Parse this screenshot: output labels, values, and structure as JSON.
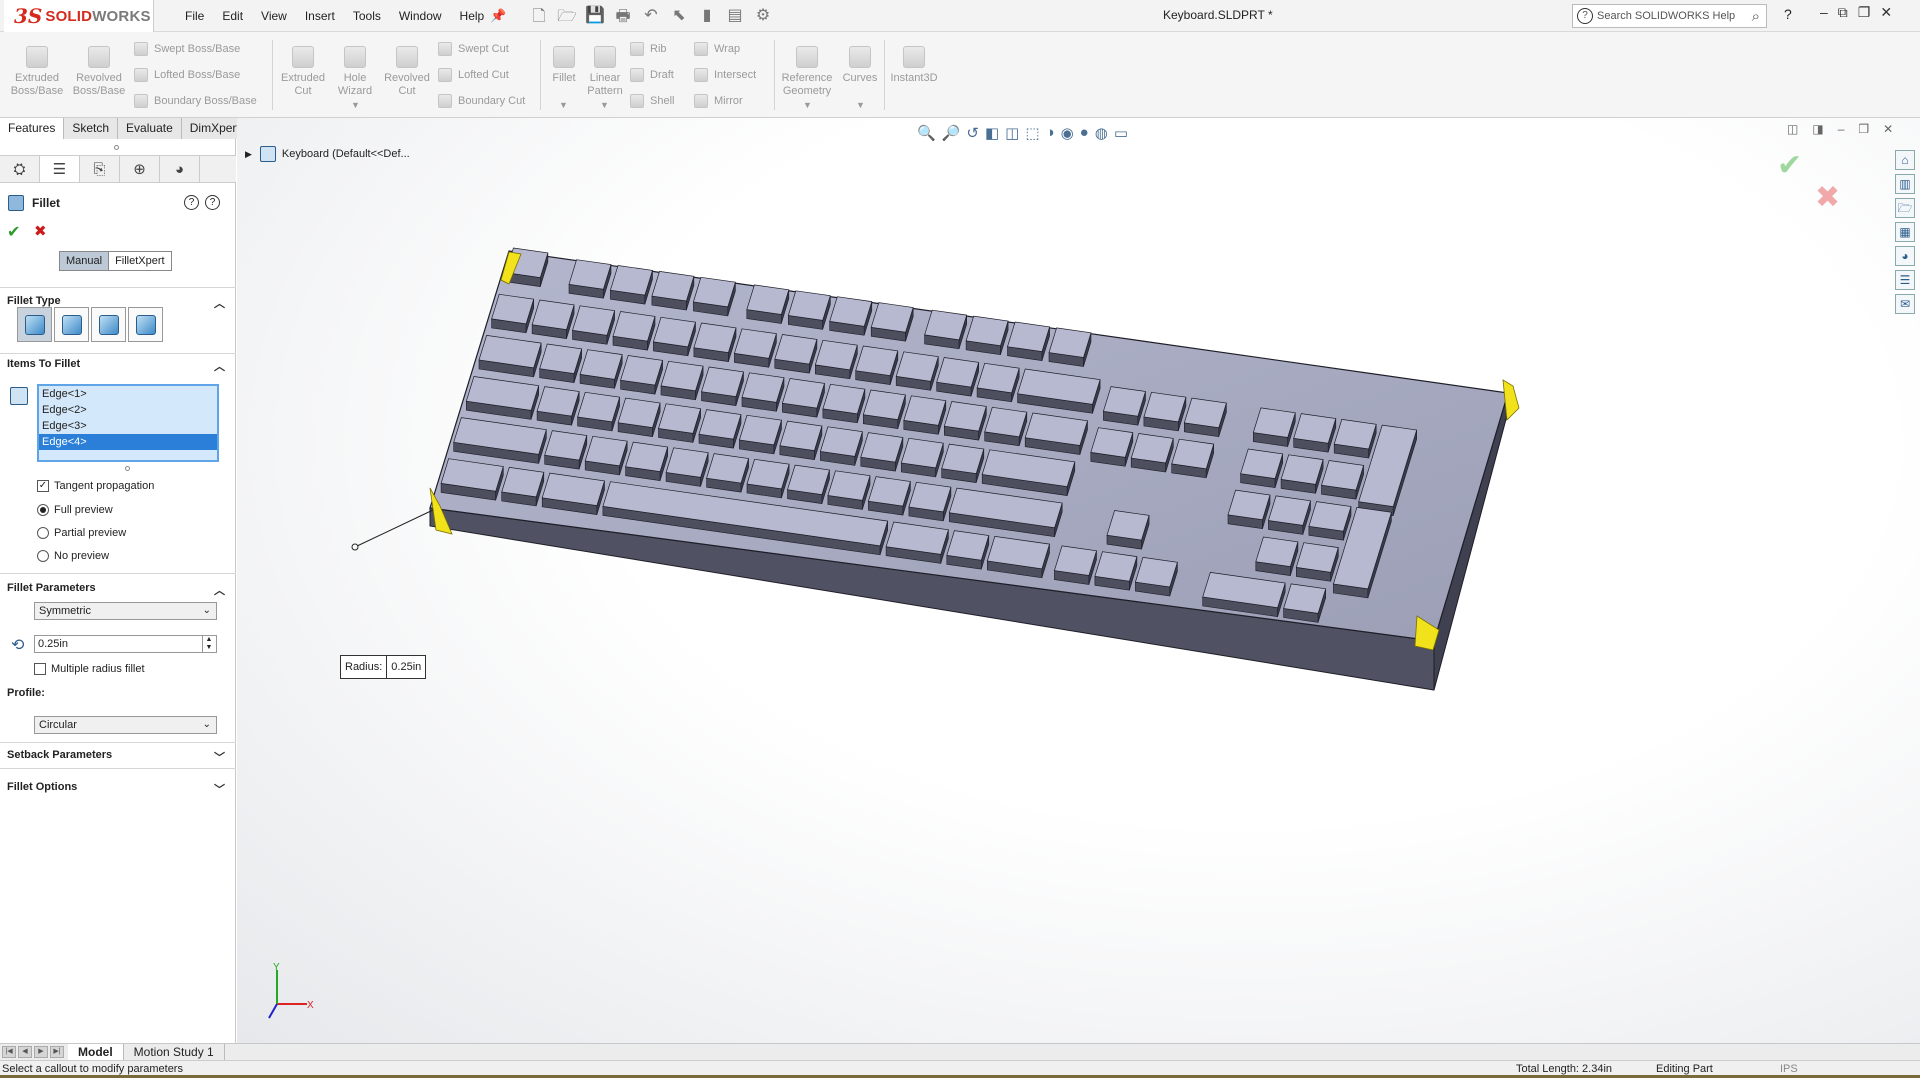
{
  "app": {
    "brand_prefix": "3S",
    "brand_name": "SOLID",
    "brand_suffix": "WORKS",
    "document_title": "Keyboard.SLDPRT *",
    "menus": [
      "File",
      "Edit",
      "View",
      "Insert",
      "Tools",
      "Window",
      "Help"
    ],
    "search_placeholder": "Search SOLIDWORKS Help",
    "help_label": "?"
  },
  "commands": {
    "extruded_boss": "Extruded Boss/Base",
    "revolved_boss": "Revolved Boss/Base",
    "swept_boss": "Swept Boss/Base",
    "lofted_boss": "Lofted Boss/Base",
    "boundary_boss": "Boundary Boss/Base",
    "extruded_cut": "Extruded Cut",
    "hole_wizard": "Hole Wizard",
    "revolved_cut": "Revolved Cut",
    "swept_cut": "Swept Cut",
    "lofted_cut": "Lofted Cut",
    "boundary_cut": "Boundary Cut",
    "fillet": "Fillet",
    "linear_pattern": "Linear Pattern",
    "rib": "Rib",
    "draft": "Draft",
    "shell": "Shell",
    "wrap": "Wrap",
    "intersect": "Intersect",
    "mirror": "Mirror",
    "reference_geometry": "Reference Geometry",
    "curves": "Curves",
    "instant3d": "Instant3D"
  },
  "command_tabs": [
    "Features",
    "Sketch",
    "Evaluate",
    "DimXpert"
  ],
  "property_manager": {
    "title": "Fillet",
    "mode_tabs": [
      "Manual",
      "FilletXpert"
    ],
    "fillet_type": {
      "header": "Fillet Type"
    },
    "items": {
      "header": "Items To Fillet",
      "edges": [
        "Edge<1>",
        "Edge<2>",
        "Edge<3>",
        "Edge<4>"
      ],
      "selected_index": 3,
      "tangent_propagation": "Tangent propagation",
      "full_preview": "Full preview",
      "partial_preview": "Partial preview",
      "no_preview": "No preview"
    },
    "parameters": {
      "header": "Fillet Parameters",
      "method": "Symmetric",
      "radius": "0.25in",
      "multiple_radius": "Multiple radius fillet",
      "profile_label": "Profile:",
      "profile": "Circular"
    },
    "setback": {
      "header": "Setback Parameters"
    },
    "options": {
      "header": "Fillet Options"
    }
  },
  "viewport": {
    "tree_item": "Keyboard  (Default<<Def...",
    "callout_label": "Radius:",
    "callout_value": "0.25in",
    "axis_x": "X",
    "axis_y": "Y"
  },
  "bottom_tabs": [
    "Model",
    "Motion Study 1"
  ],
  "status": {
    "message": "Select a callout to modify parameters",
    "total_length": "Total Length: 2.34in",
    "mode": "Editing Part",
    "units": "IPS"
  },
  "colors": {
    "body_top": "#a6a9c0",
    "body_side": "#4d4e5e",
    "key_top": "#b6b9cf",
    "selected_edge": "#f2e21b",
    "accent": "#d52b1e"
  }
}
